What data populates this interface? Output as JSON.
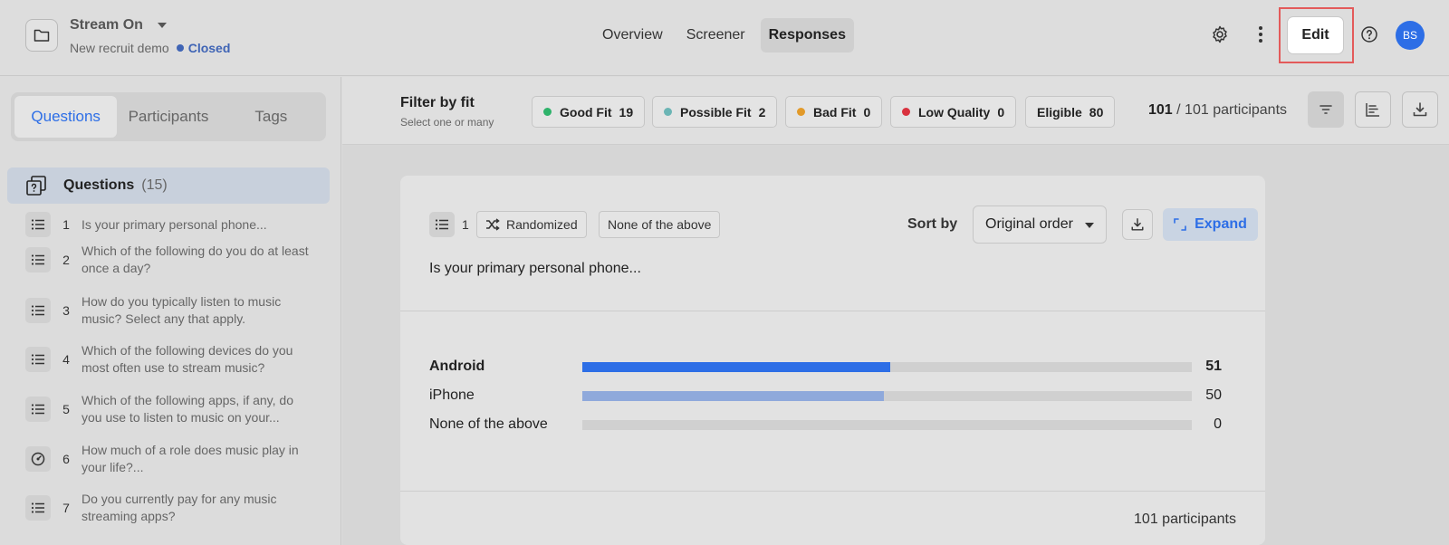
{
  "project": {
    "title": "Stream On",
    "subtitle": "New recruit demo",
    "status": "Closed"
  },
  "nav": {
    "tabs": [
      "Overview",
      "Screener",
      "Responses"
    ],
    "active": "Responses"
  },
  "header": {
    "edit_label": "Edit",
    "avatar_initials": "BS"
  },
  "sidebar": {
    "tabs": [
      "Questions",
      "Participants",
      "Tags"
    ],
    "active_tab": "Questions",
    "questions_label": "Questions",
    "questions_count": "(15)",
    "items": [
      {
        "num": "1",
        "text": "Is your primary personal phone...",
        "icon": "list-icon"
      },
      {
        "num": "2",
        "text": "Which of the following do you do at least once a day?",
        "icon": "list-icon"
      },
      {
        "num": "3",
        "text": "How do you typically listen to music music? Select any that apply.",
        "icon": "list-icon"
      },
      {
        "num": "4",
        "text": "Which of the following devices do you most often use to stream music?",
        "icon": "list-icon"
      },
      {
        "num": "5",
        "text": "Which of the following apps, if any, do you use to listen to music on your...",
        "icon": "list-icon"
      },
      {
        "num": "6",
        "text": "How much of a role does music play in your life?...",
        "icon": "gauge-icon"
      },
      {
        "num": "7",
        "text": "Do you currently pay for any music streaming apps?",
        "icon": "list-icon"
      }
    ]
  },
  "filter": {
    "title": "Filter by fit",
    "subtitle": "Select one or many",
    "chips": [
      {
        "label": "Good Fit",
        "count": "19",
        "color": "#2fb36b"
      },
      {
        "label": "Possible Fit",
        "count": "2",
        "color": "#6bb5b5"
      },
      {
        "label": "Bad Fit",
        "count": "0",
        "color": "#e29a2a"
      },
      {
        "label": "Low Quality",
        "count": "0",
        "color": "#d9323e"
      },
      {
        "label": "Eligible",
        "count": "80",
        "color": ""
      }
    ],
    "participants_shown": "101",
    "participants_total": "/ 101 participants"
  },
  "card": {
    "question_number": "1",
    "tags": [
      "Randomized",
      "None of the above"
    ],
    "sort_label": "Sort by",
    "sort_value": "Original order",
    "expand_label": "Expand",
    "question_text": "Is your primary personal phone...",
    "footer": "101 participants"
  },
  "chart_data": {
    "type": "bar",
    "categories": [
      "Android",
      "iPhone",
      "None of the above"
    ],
    "values": [
      51,
      50,
      0
    ],
    "total": 101,
    "colors": [
      "#2d6ee6",
      "#8fa9db",
      "#d0d0d0"
    ]
  }
}
